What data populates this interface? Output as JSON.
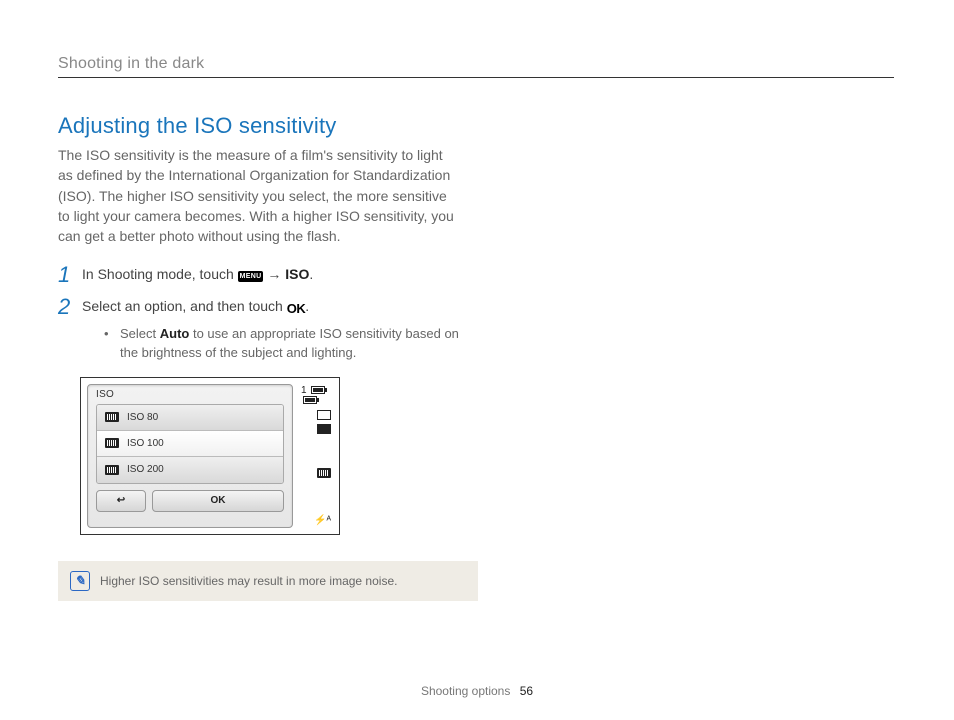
{
  "running_head": "Shooting in the dark",
  "section_title": "Adjusting the ISO sensitivity",
  "body": "The ISO sensitivity is the measure of a film's sensitivity to light as defined by the International Organization for Standardization (ISO). The higher ISO sensitivity you select, the more sensitive to light your camera becomes. With a higher ISO sensitivity, you can get a better photo without using the flash.",
  "steps": [
    {
      "num": "1",
      "prefix": "In Shooting mode, touch ",
      "menu_icon": "MENU",
      "arrow": " → ",
      "bold_after": "ISO",
      "suffix": "."
    },
    {
      "num": "2",
      "prefix": "Select an option, and then touch ",
      "ok_glyph": "OK",
      "suffix": "."
    }
  ],
  "sub_bullet": {
    "prefix": "Select ",
    "bold": "Auto",
    "suffix": " to use an appropriate ISO sensitivity based on the brightness of the subject and lighting."
  },
  "screenshot": {
    "title": "ISO",
    "rows": [
      {
        "label": "ISO 80",
        "selected": false
      },
      {
        "label": "ISO 100",
        "selected": true
      },
      {
        "label": "ISO 200",
        "selected": false
      }
    ],
    "back_glyph": "↩",
    "ok_label": "OK",
    "top_right_digit": "1",
    "flash_label": "⚡ᴬ"
  },
  "note": "Higher ISO sensitivities may result in more image noise.",
  "footer": {
    "section": "Shooting options",
    "page": "56"
  }
}
